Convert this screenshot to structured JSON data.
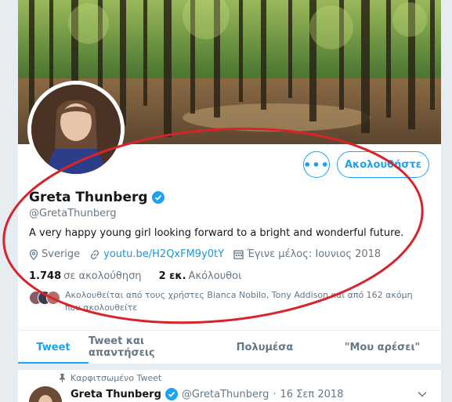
{
  "profile": {
    "name": "Greta Thunberg",
    "handle": "@GretaThunberg",
    "bio": "A very happy young girl looking forward to a bright and wonderful future.",
    "location": "Sverige",
    "link": "youtu.be/H2QxFM9y0tY",
    "joined": "Έγινε μέλος: Ιουνιος 2018",
    "following_count": "1.748",
    "following_label": "σε ακολούθηση",
    "followers_count": "2 εκ.",
    "followers_label": "Ακόλουθοι",
    "followed_by_text": "Ακολουθείται από τους χρήστες Bianca Nobilo, Tony Addison και από 162 ακόμη που ακολουθείτε"
  },
  "actions": {
    "more_label": "•••",
    "follow_label": "Ακολουθήστε"
  },
  "tabs": [
    {
      "label": "Tweet",
      "active": true
    },
    {
      "label": "Tweet και απαντήσεις",
      "active": false
    },
    {
      "label": "Πολυμέσα",
      "active": false
    },
    {
      "label": "\"Μου αρέσει\"",
      "active": false
    }
  ],
  "pinned": {
    "label": "Καρφιτσωμένο Tweet",
    "author": "Greta Thunberg",
    "handle": "@GretaThunberg",
    "separator": "·",
    "date": "16 Σεπ 2018"
  },
  "colors": {
    "accent": "#1da1f2",
    "annotation": "#d8232a"
  },
  "icons": [
    "verified-icon",
    "location-icon",
    "link-icon",
    "calendar-icon",
    "pin-icon",
    "chevron-down-icon"
  ]
}
